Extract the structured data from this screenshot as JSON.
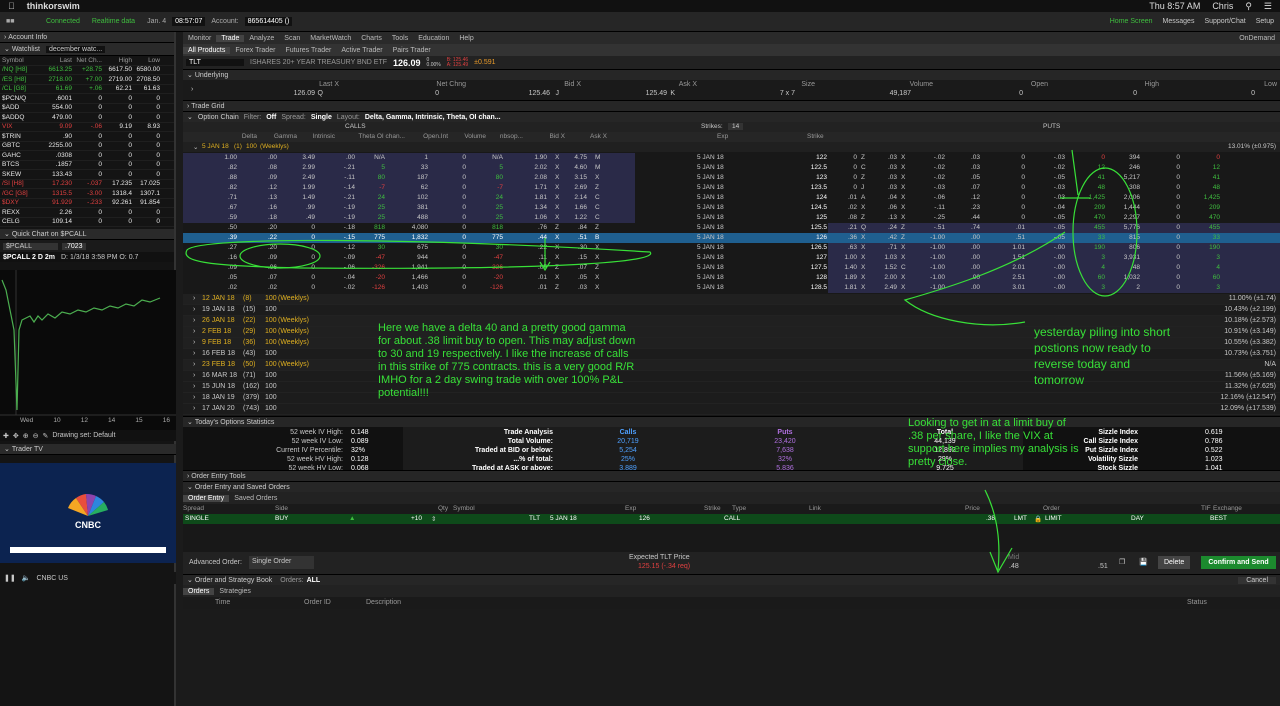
{
  "mac": {
    "app": "thinkorswim",
    "clock": "Thu 8:57 AM",
    "user": "Chris"
  },
  "status": {
    "connected": "Connected",
    "realtime": "Realtime data",
    "date": "Jan. 4",
    "time": "08:57:07",
    "account_label": "Account:",
    "account": "865614405 ()",
    "home": "Home Screen",
    "messages": "Messages",
    "support": "Support/Chat",
    "setup": "Setup",
    "ondemand": "OnDemand"
  },
  "left": {
    "account_info": "Account Info",
    "watchlist_label": "Watchlist",
    "watchlist_name": "december watc...",
    "wl_headers": [
      "Symbol",
      "Last",
      "Net Ch...",
      "High",
      "Low"
    ],
    "wl_rows": [
      [
        "/NQ [H8]",
        "6613.25",
        "+28.75",
        "6617.50",
        "6580.00",
        "pos"
      ],
      [
        "/ES [H8]",
        "2718.00",
        "+7.00",
        "2719.00",
        "2708.50",
        "pos"
      ],
      [
        "/CL [G8]",
        "61.69",
        "+.06",
        "62.21",
        "61.63",
        "pos"
      ],
      [
        "$PCN/Q",
        ".6001",
        "0",
        "0",
        "0",
        "wht"
      ],
      [
        "$ADD",
        "554.00",
        "0",
        "0",
        "0",
        "wht"
      ],
      [
        "$ADDQ",
        "479.00",
        "0",
        "0",
        "0",
        "wht"
      ],
      [
        "VIX",
        "9.09",
        "-.06",
        "9.19",
        "8.93",
        "neg"
      ],
      [
        "$TRIN",
        ".90",
        "0",
        "0",
        "0",
        "wht"
      ],
      [
        "GBTC",
        "2255.00",
        "0",
        "0",
        "0",
        "wht"
      ],
      [
        "GAHC",
        ".0308",
        "0",
        "0",
        "0",
        "wht"
      ],
      [
        "BTCS",
        ".1857",
        "0",
        "0",
        "0",
        "wht"
      ],
      [
        "SKEW",
        "133.43",
        "0",
        "0",
        "0",
        "wht"
      ],
      [
        "/SI [H8]",
        "17.230",
        "-.037",
        "17.235",
        "17.025",
        "neg"
      ],
      [
        "/GC [G8]",
        "1315.5",
        "-3.00",
        "1318.4",
        "1307.1",
        "neg"
      ],
      [
        "$DXY",
        "91.929",
        "-.233",
        "92.261",
        "91.854",
        "neg"
      ],
      [
        "REXX",
        "2.26",
        "0",
        "0",
        "0",
        "wht"
      ],
      [
        "CELG",
        "109.14",
        "0",
        "0",
        "0",
        "wht"
      ]
    ],
    "quick_chart": "Quick Chart on $PCALL",
    "qc_symbol": "$PCALL",
    "qc_value": ".7023",
    "chart_label": "$PCALL 2 D 2m",
    "chart_info": "D: 1/3/18 3:58 PM  O: 0.7",
    "chart_xticks": [
      "Wed",
      "10",
      "12",
      "14",
      "15",
      "16"
    ],
    "drawing_set": "Drawing set: Default",
    "trader_tv": "Trader TV",
    "tv_logo": "CNBC",
    "tv_channel": "CNBC US"
  },
  "main": {
    "tabs": [
      "Monitor",
      "Trade",
      "Analyze",
      "Scan",
      "MarketWatch",
      "Charts",
      "Tools",
      "Education",
      "Help"
    ],
    "subtabs": [
      "All Products",
      "Forex Trader",
      "Futures Trader",
      "Active Trader",
      "Pairs Trader"
    ],
    "symbol": "TLT",
    "symbol_desc": "ISHARES 20+ YEAR TREASURY BND ETF",
    "price": "126.09",
    "price_chg": "0",
    "price_pct": "0.00%",
    "bid_small": "B: 125.46",
    "ask_small": "A: 125.49",
    "delta_small": "±0.591",
    "underlying_label": "Underlying",
    "und_headers": [
      "Last X",
      "Net Chng",
      "Bid X",
      "Ask X",
      "Size",
      "Volume",
      "Open",
      "High",
      "Low"
    ],
    "und_values": [
      "126.09",
      "Q",
      "0",
      "125.46",
      "J",
      "125.49",
      "K",
      "7 x 7",
      "49,187",
      "0",
      "0",
      "0"
    ],
    "trade_grid": "Trade Grid",
    "option_chain": "Option Chain",
    "filter_label": "Filter:",
    "filter": "Off",
    "spread_label": "Spread:",
    "spread": "Single",
    "layout_label": "Layout:",
    "layout": "Delta, Gamma, Intrinsic, Theta, OI chan...",
    "calls": "CALLS",
    "puts": "PUTS",
    "strikes_label": "Strikes:",
    "strikes": "14",
    "call_headers": [
      "Delta",
      "Gamma",
      "Intrinsic",
      "Theta",
      "OI chan...",
      "Open.Int",
      "Volume",
      "nbsop...",
      "Bid X",
      "Ask X"
    ],
    "mid_headers": [
      "Exp",
      "Strike"
    ],
    "put_headers": [
      "Bid X",
      "Ask X",
      "Delta",
      "Gamma",
      "Intrinsic",
      "Theta",
      "OI chan...",
      "Open.Int",
      "Volume",
      "nbsop..."
    ],
    "exp_header": "5 JAN 18",
    "exp_days": "(1)",
    "exp_count": "100",
    "exp_weekly": "(Weeklys)",
    "exp_pct": "13.01% (±0.975)",
    "chain_rows": [
      {
        "c": [
          "1.00",
          ".00",
          "3.49",
          ".00",
          "N/A",
          "1",
          "0",
          "N/A",
          "1.90",
          "X",
          "4.75",
          "M"
        ],
        "exp": "5 JAN 18",
        "k": "122",
        "p": [
          "0",
          "Z",
          ".03",
          "X",
          "-.02",
          ".03",
          "0",
          "-.03",
          "0",
          "394",
          "0",
          "0"
        ],
        "itm": "call"
      },
      {
        "c": [
          ".82",
          ".08",
          "2.99",
          "-.21",
          "5",
          "33",
          "0",
          "5",
          "2.02",
          "X",
          "4.60",
          "M"
        ],
        "exp": "5 JAN 18",
        "k": "122.5",
        "p": [
          "0",
          "C",
          ".03",
          "X",
          "-.02",
          ".03",
          "0",
          "-.02",
          "12",
          "246",
          "0",
          "12"
        ],
        "itm": "call"
      },
      {
        "c": [
          ".88",
          ".09",
          "2.49",
          "-.11",
          "80",
          "187",
          "0",
          "80",
          "2.08",
          "X",
          "3.15",
          "X"
        ],
        "exp": "5 JAN 18",
        "k": "123",
        "p": [
          "0",
          "Z",
          ".03",
          "X",
          "-.02",
          ".05",
          "0",
          "-.05",
          "41",
          "5,217",
          "0",
          "41"
        ],
        "itm": "call"
      },
      {
        "c": [
          ".82",
          ".12",
          "1.99",
          "-.14",
          "-7",
          "62",
          "0",
          "-7",
          "1.71",
          "X",
          "2.69",
          "Z"
        ],
        "exp": "5 JAN 18",
        "k": "123.5",
        "p": [
          "0",
          "J",
          ".03",
          "X",
          "-.03",
          ".07",
          "0",
          "-.03",
          "48",
          "308",
          "0",
          "48"
        ],
        "itm": "call"
      },
      {
        "c": [
          ".71",
          ".13",
          "1.49",
          "-.21",
          "24",
          "102",
          "0",
          "24",
          "1.81",
          "X",
          "2.14",
          "C"
        ],
        "exp": "5 JAN 18",
        "k": "124",
        "p": [
          ".01",
          "A",
          ".04",
          "X",
          "-.06",
          ".12",
          "0",
          "-.03",
          "1,425",
          "2,006",
          "0",
          "1,425"
        ],
        "itm": "call"
      },
      {
        "c": [
          ".67",
          ".16",
          ".99",
          "-.19",
          "25",
          "381",
          "0",
          "25",
          "1.34",
          "X",
          "1.66",
          "C"
        ],
        "exp": "5 JAN 18",
        "k": "124.5",
        "p": [
          ".02",
          "X",
          ".06",
          "X",
          "-.11",
          ".23",
          "0",
          "-.04",
          "209",
          "1,444",
          "0",
          "209"
        ],
        "itm": "call"
      },
      {
        "c": [
          ".59",
          ".18",
          ".49",
          "-.19",
          "25",
          "488",
          "0",
          "25",
          "1.06",
          "X",
          "1.22",
          "C"
        ],
        "exp": "5 JAN 18",
        "k": "125",
        "p": [
          ".08",
          "Z",
          ".13",
          "X",
          "-.25",
          ".44",
          "0",
          "-.05",
          "470",
          "2,297",
          "0",
          "470"
        ],
        "itm": "call"
      },
      {
        "c": [
          ".50",
          ".20",
          "0",
          "-.18",
          "818",
          "4,080",
          "0",
          "818",
          ".76",
          "Z",
          ".84",
          "Z"
        ],
        "exp": "5 JAN 18",
        "k": "125.5",
        "p": [
          ".21",
          "Q",
          ".24",
          "Z",
          "-.51",
          ".74",
          ".01",
          "-.05",
          "455",
          "5,776",
          "0",
          "455"
        ],
        "itm": "put"
      },
      {
        "c": [
          ".39",
          ".22",
          "0",
          "-.15",
          "775",
          "1,832",
          "0",
          "775",
          ".44",
          "X",
          ".51",
          "B"
        ],
        "exp": "5 JAN 18",
        "k": "126",
        "p": [
          ".36",
          "X",
          ".42",
          "Z",
          "-1.00",
          ".00",
          ".51",
          "-.05",
          "33",
          "815",
          "0",
          "33"
        ],
        "itm": "sel"
      },
      {
        "c": [
          ".27",
          ".20",
          "0",
          "-.12",
          "30",
          "675",
          "0",
          "30",
          ".22",
          "X",
          ".30",
          "X"
        ],
        "exp": "5 JAN 18",
        "k": "126.5",
        "p": [
          ".63",
          "X",
          ".71",
          "X",
          "-1.00",
          ".00",
          "1.01",
          "-.00",
          "190",
          "806",
          "0",
          "190"
        ],
        "itm": "put"
      },
      {
        "c": [
          ".16",
          ".09",
          "0",
          "-.09",
          "-47",
          "944",
          "0",
          "-47",
          ".11",
          "X",
          ".15",
          "X"
        ],
        "exp": "5 JAN 18",
        "k": "127",
        "p": [
          "1.00",
          "X",
          "1.03",
          "X",
          "-1.00",
          ".00",
          "1.51",
          "-.00",
          "3",
          "3,931",
          "0",
          "3"
        ],
        "itm": "put"
      },
      {
        "c": [
          ".09",
          ".06",
          "0",
          "-.06",
          "-326",
          "1,941",
          "0",
          "-326",
          ".05",
          "Z",
          ".07",
          "Z"
        ],
        "exp": "5 JAN 18",
        "k": "127.5",
        "p": [
          "1.40",
          "X",
          "1.52",
          "C",
          "-1.00",
          ".00",
          "2.01",
          "-.00",
          "4",
          "48",
          "0",
          "4"
        ],
        "itm": "put"
      },
      {
        "c": [
          ".05",
          ".07",
          "0",
          "-.04",
          "-20",
          "1,466",
          "0",
          "-20",
          ".01",
          "X",
          ".05",
          "X"
        ],
        "exp": "5 JAN 18",
        "k": "128",
        "p": [
          "1.89",
          "X",
          "2.00",
          "X",
          "-1.00",
          ".00",
          "2.51",
          "-.00",
          "60",
          "1,032",
          "0",
          "60"
        ],
        "itm": "put"
      },
      {
        "c": [
          ".02",
          ".02",
          "0",
          "-.02",
          "-126",
          "1,403",
          "0",
          "-126",
          ".01",
          "Z",
          ".03",
          "X"
        ],
        "exp": "5 JAN 18",
        "k": "128.5",
        "p": [
          "1.81",
          "X",
          "2.49",
          "X",
          "-1.00",
          ".00",
          "3.01",
          "-.00",
          "3",
          "2",
          "0",
          "3"
        ],
        "itm": "put"
      }
    ],
    "expirations": [
      {
        "d": "12 JAN 18",
        "n": "(8)",
        "c": "100",
        "w": "(Weeklys)",
        "pct": "11.00% (±1.74)"
      },
      {
        "d": "19 JAN 18",
        "n": "(15)",
        "c": "100",
        "w": "",
        "pct": "10.43% (±2.199)"
      },
      {
        "d": "26 JAN 18",
        "n": "(22)",
        "c": "100",
        "w": "(Weeklys)",
        "pct": "10.18% (±2.573)"
      },
      {
        "d": "2 FEB 18",
        "n": "(29)",
        "c": "100",
        "w": "(Weeklys)",
        "pct": "10.91% (±3.149)"
      },
      {
        "d": "9 FEB 18",
        "n": "(36)",
        "c": "100",
        "w": "(Weeklys)",
        "pct": "10.55% (±3.382)"
      },
      {
        "d": "16 FEB 18",
        "n": "(43)",
        "c": "100",
        "w": "",
        "pct": "10.73% (±3.751)"
      },
      {
        "d": "23 FEB 18",
        "n": "(50)",
        "c": "100",
        "w": "(Weeklys)",
        "pct": "N/A"
      },
      {
        "d": "16 MAR 18",
        "n": "(71)",
        "c": "100",
        "w": "",
        "pct": "11.56% (±5.169)"
      },
      {
        "d": "15 JUN 18",
        "n": "(162)",
        "c": "100",
        "w": "",
        "pct": "11.32% (±7.625)"
      },
      {
        "d": "18 JAN 19",
        "n": "(379)",
        "c": "100",
        "w": "",
        "pct": "12.16% (±12.547)"
      },
      {
        "d": "17 JAN 20",
        "n": "(743)",
        "c": "100",
        "w": "",
        "pct": "12.09% (±17.539)"
      }
    ],
    "annot1": "Here we have a delta 40 and a pretty good gamma for about .38 limit buy to open.  This may adjust down to 30 and 19 respectively.  I like the increase of calls in this strike of 775 contracts. this is a very good R/R IMHO for a 2 day swing trade with over 100% P&L potential!!!",
    "annot2": "yesterday piling into short postions now ready to reverse today and tomorrow",
    "annot3": "Looking to get in at a limit buy of .38 per share, I like the VIX at support here implies my analysis is pretty close.",
    "stats_title": "Today's Options Statistics",
    "stats_left": [
      [
        "52 week IV High:",
        "0.148"
      ],
      [
        "52 week IV Low:",
        "0.089"
      ],
      [
        "Current IV Percentile:",
        "32%"
      ],
      [
        "52 week HV High:",
        "0.128"
      ],
      [
        "52 week HV Low:",
        "0.068"
      ]
    ],
    "ta_headers": [
      "Trade Analysis",
      "Calls",
      "Puts",
      "Total"
    ],
    "ta_rows": [
      [
        "Total Volume:",
        "20,719",
        "23,420",
        "44,139"
      ],
      [
        "Traded at BID or below:",
        "5,254",
        "7,638",
        "12,892"
      ],
      [
        "...% of total:",
        "25%",
        "32%",
        "29%"
      ],
      [
        "Traded at ASK or above:",
        "3,889",
        "5,836",
        "9,725"
      ]
    ],
    "sizzle": [
      [
        "Sizzle Index",
        "0.619"
      ],
      [
        "Call Sizzle Index",
        "0.786"
      ],
      [
        "Put Sizzle Index",
        "0.522"
      ],
      [
        "Volatility Sizzle",
        "1.023"
      ],
      [
        "Stock Sizzle",
        "1.041"
      ]
    ],
    "order_tools": "Order Entry Tools",
    "order_entry_title": "Order Entry and Saved Orders",
    "order_tabs": [
      "Order Entry",
      "Saved Orders"
    ],
    "order_headers": [
      "Spread",
      "Side",
      "Qty",
      "Symbol",
      "Exp",
      "Strike",
      "Type",
      "Link",
      "Price",
      "Order",
      "TIF",
      "Exchange"
    ],
    "order_values": [
      "SINGLE",
      "BUY",
      "+10",
      "TLT",
      "5 JAN 18",
      "126",
      "CALL",
      ".38",
      "LMT",
      "LIMIT",
      "DAY",
      "BEST"
    ],
    "advanced_label": "Advanced Order:",
    "advanced": "Single Order",
    "expected_label": "Expected  TLT  Price",
    "expected_val": "125.15 (-.34 req)",
    "mid_label": "Mid",
    "mid_bid": ".48",
    "mid_ask": ".51",
    "delete": "Delete",
    "confirm": "Confirm and Send",
    "book_title": "Order and Strategy Book",
    "book_orders_label": "Orders:",
    "book_orders": "ALL",
    "book_tabs": [
      "Orders",
      "Strategies"
    ],
    "book_headers": [
      "Time",
      "Order ID",
      "Description",
      "Status"
    ],
    "cancel": "Cancel",
    "colors": {
      "green_annot": "#38e038",
      "selected_row": "#1f5f8f",
      "itm_bg": "#2a2a48",
      "confirm": "#1c8a2e"
    }
  }
}
